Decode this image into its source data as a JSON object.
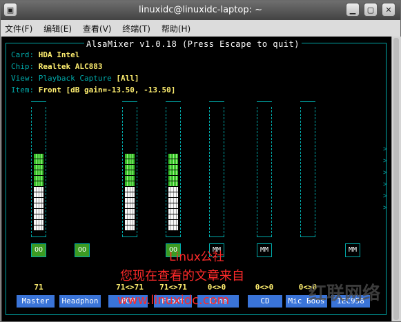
{
  "window": {
    "title": "linuxidc@linuxidc-laptop: ~"
  },
  "menu": [
    "文件(F)",
    "编辑(E)",
    "查看(V)",
    "终端(T)",
    "帮助(H)"
  ],
  "mixer": {
    "header": "AlsaMixer v1.0.18 (Press Escape to quit)",
    "card_label": "Card:",
    "card_value": "HDA Intel",
    "chip_label": "Chip:",
    "chip_value": "Realtek ALC883",
    "view_label": "View:",
    "view_playback": "Playback",
    "view_capture": "Capture",
    "view_all": "[All]",
    "item_label": "Item:",
    "item_value": "Front [dB gain=-13.50, -13.50]"
  },
  "channels": [
    {
      "name": "Master",
      "volume": "71",
      "level": 0.71,
      "mute": "OO"
    },
    {
      "name": "Headphon",
      "volume": "",
      "level": null,
      "mute": "OO"
    },
    {
      "name": "PCM",
      "volume": "71<>71",
      "level": 0.71,
      "mute": ""
    },
    {
      "name": "Front",
      "volume": "71<>71",
      "level": 0.71,
      "mute": "OO"
    },
    {
      "name": "Line",
      "volume": "0<>0",
      "level": 0,
      "mute": "MM"
    },
    {
      "name": "CD",
      "volume": "0<>0",
      "level": 0,
      "mute": "MM"
    },
    {
      "name": "Mic Boos",
      "volume": "0<>0",
      "level": 0,
      "mute": ""
    },
    {
      "name": "IEC958",
      "volume": "",
      "level": null,
      "mute": "MM"
    }
  ],
  "watermark": {
    "line1": "Linux公社",
    "line2": "您现在查看的文章来自",
    "line3": "www.linuxidc.com",
    "logo": "红联网络"
  },
  "colors": {
    "cyan": "#00aaaa",
    "yellow": "#ffef70",
    "green": "#38c02a",
    "label_bg": "#3a74d8",
    "watermark": "#ff2a2a"
  }
}
